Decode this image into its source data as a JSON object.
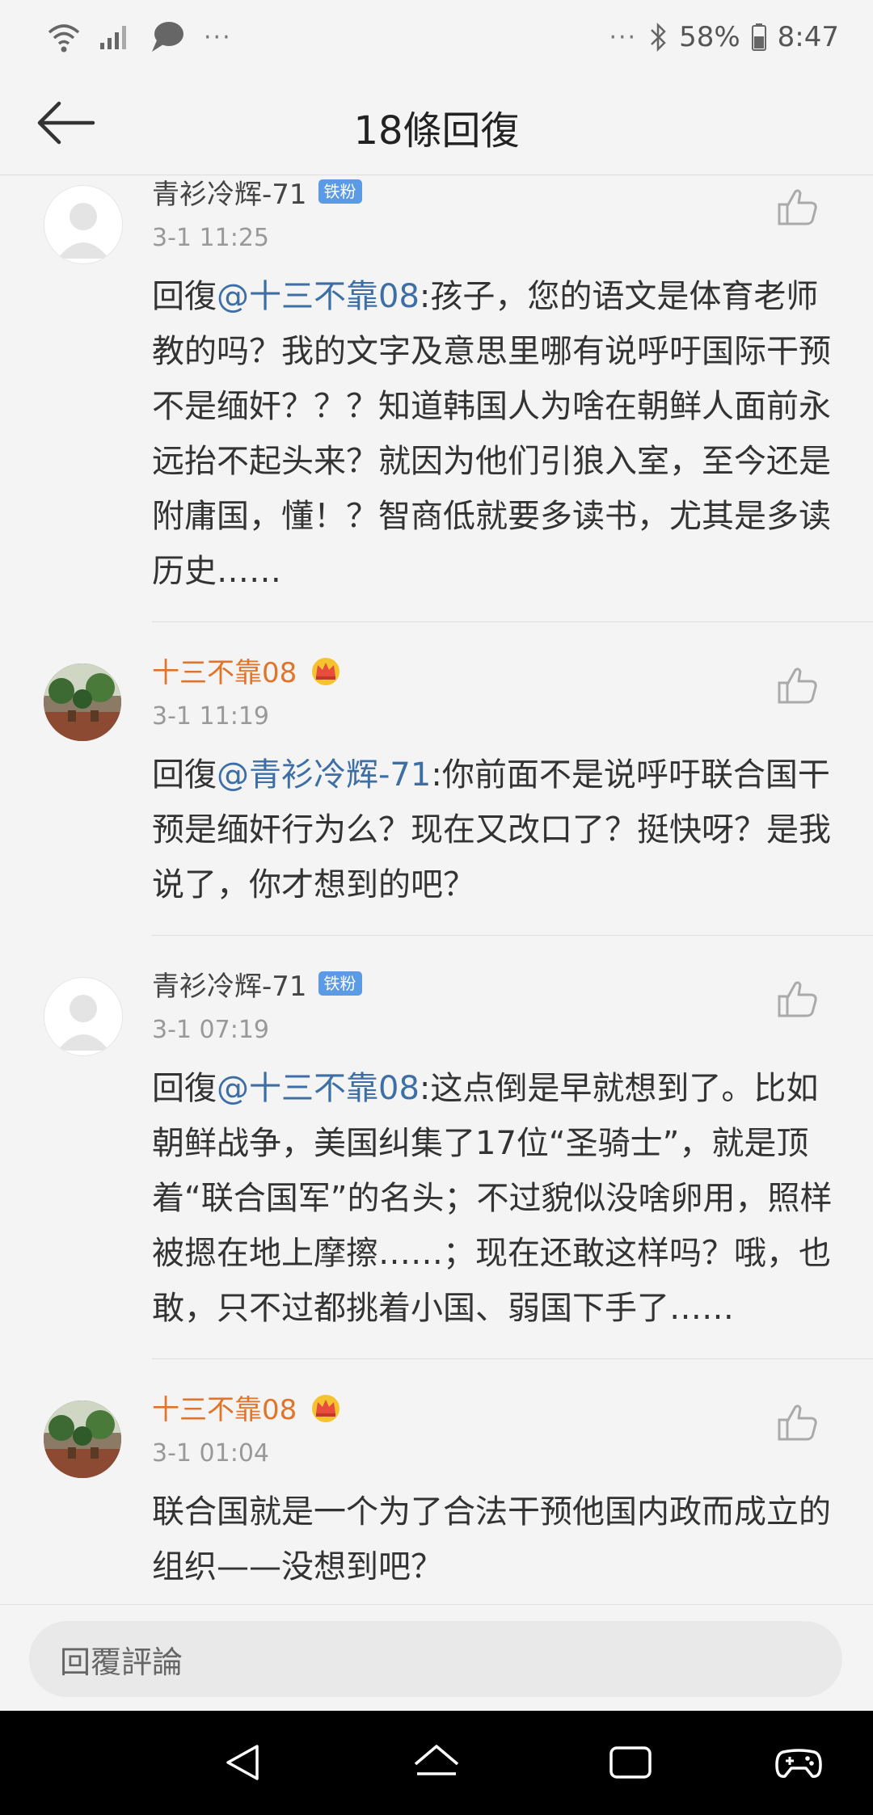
{
  "status_bar": {
    "battery": "58%",
    "time": "8:47",
    "left_overflow": "···",
    "right_overflow": "···"
  },
  "header": {
    "title": "18條回復"
  },
  "comments": [
    {
      "name": "青衫冷辉-71",
      "badge": "铁粉",
      "time": "3-1 11:25",
      "prefix": "回復",
      "mention": "@十三不靠08",
      "text": ":孩子，您的语文是体育老师教的吗？我的文字及意思里哪有说呼吁国际干预不是缅奸？？？知道韩国人为啥在朝鲜人面前永远抬不起头来？就因为他们引狼入室，至今还是附庸国，懂！？智商低就要多读书，尤其是多读历史……"
    },
    {
      "name": "十三不靠08",
      "time": "3-1 11:19",
      "prefix": "回復",
      "mention": "@青衫冷辉-71",
      "text": ":你前面不是说呼吁联合国干预是缅奸行为么？现在又改口了？挺快呀？是我说了，你才想到的吧？"
    },
    {
      "name": "青衫冷辉-71",
      "badge": "铁粉",
      "time": "3-1 07:19",
      "prefix": "回復",
      "mention": "@十三不靠08",
      "text": ":这点倒是早就想到了。比如朝鲜战争，美国纠集了17位“圣骑士”，就是顶着“联合国军”的名头；不过貌似没啥卵用，照样被摁在地上摩擦……；现在还敢这样吗？哦，也敢，只不过都挑着小国、弱国下手了……"
    },
    {
      "name": "十三不靠08",
      "time": "3-1 01:04",
      "text": "联合国就是一个为了合法干预他国内政而成立的组织——没想到吧？"
    }
  ],
  "reply_bar": {
    "placeholder": "回覆評論"
  },
  "nav_bar": {
    "buttons": [
      "back-icon",
      "home-icon",
      "recents-icon",
      "game-icon"
    ]
  },
  "colors": {
    "mention": "#3d6ea5",
    "vip_name": "#e0742a",
    "badge": "#5b9be6",
    "time": "#999999"
  }
}
